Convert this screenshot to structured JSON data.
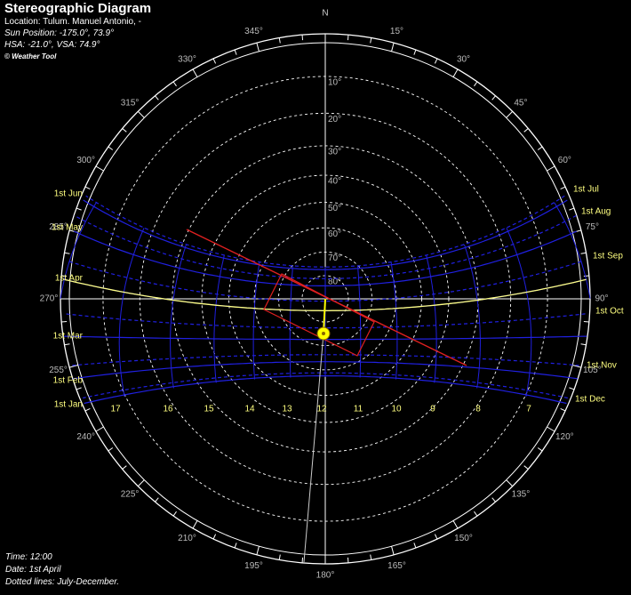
{
  "header": {
    "title": "Stereographic Diagram",
    "location": "Location: Tulum. Manuel Antonio, -",
    "sun_position": "Sun Position: -175.0°, 73.9°",
    "shadow_angles": "HSA: -21.0°, VSA: 74.9°",
    "copyright": "© Weather Tool"
  },
  "footer": {
    "time": "Time: 12:00",
    "date": "Date: 1st April",
    "note": "Dotted lines: July-December."
  },
  "compass": {
    "north_label": "N",
    "bearing_labels": [
      "15°",
      "30°",
      "45°",
      "60°",
      "75°",
      "90°",
      "105°",
      "120°",
      "135°",
      "150°",
      "165°",
      "180°",
      "195°",
      "210°",
      "225°",
      "240°",
      "255°",
      "270°",
      "285°",
      "300°",
      "315°",
      "330°",
      "345°"
    ]
  },
  "altitude_labels": [
    "10°",
    "20°",
    "30°",
    "40°",
    "50°",
    "60°",
    "70°",
    "80°"
  ],
  "months_left": [
    "1st Jun",
    "1st May",
    "1st Apr",
    "1st Mar",
    "1st Feb",
    "1st Jan"
  ],
  "months_right": [
    "1st Jul",
    "1st Aug",
    "1st Sep",
    "1st Oct",
    "1st Nov",
    "1st Dec"
  ],
  "hour_labels": [
    "17",
    "16",
    "15",
    "14",
    "13",
    "12",
    "11",
    "10",
    "9",
    "8",
    "7"
  ],
  "sun": {
    "azimuth": -175.0,
    "altitude": 73.9,
    "hsa": -21.0,
    "vsa": 74.9
  },
  "colors": {
    "background": "#000000",
    "grid": "#ffffff",
    "sunpath": "#2020e0",
    "current_path": "#ffff80",
    "sun": "#ffff00",
    "shadow_line": "#e02020",
    "month_label": "#ffff80",
    "degree_label": "#bbbbbb"
  }
}
